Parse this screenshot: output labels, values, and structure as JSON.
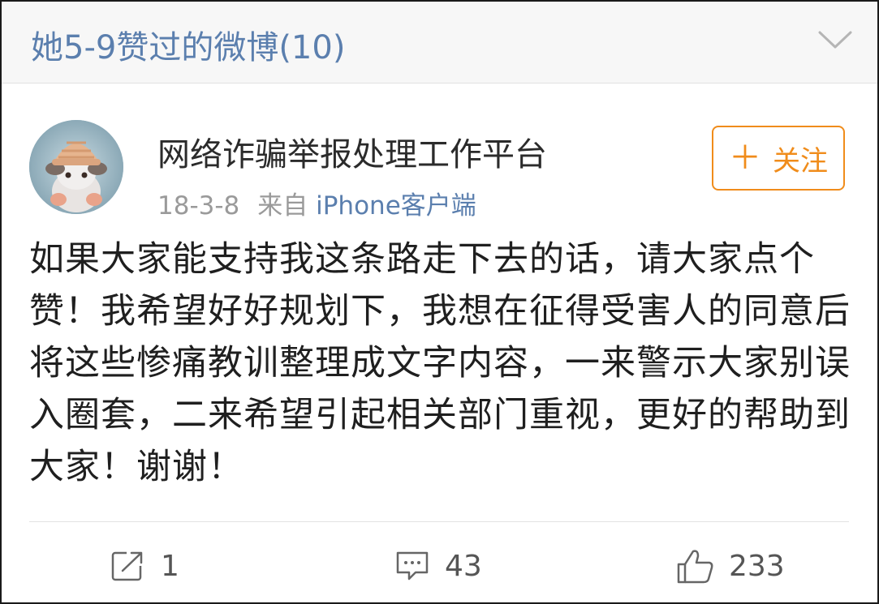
{
  "header": {
    "title": "她5-9赞过的微博(10)",
    "chevron_icon": "chevron-down-icon"
  },
  "post": {
    "author": "网络诈骗举报处理工作平台",
    "date": "18-3-8",
    "source_prefix": "来自",
    "source": "iPhone客户端",
    "follow_label": "关注",
    "follow_icon": "plus-icon",
    "content": "如果大家能支持我这条路走下去的话，请大家点个赞！我希望好好规划下，我想在征得受害人的同意后将这些惨痛教训整理成文字内容，一来警示大家别误入圈套，二来希望引起相关部门重视，更好的帮助到大家！谢谢！"
  },
  "actions": {
    "repost_count": "1",
    "comment_count": "43",
    "like_count": "233"
  },
  "colors": {
    "link_blue": "#5b7fae",
    "follow_orange": "#f08c1b"
  }
}
